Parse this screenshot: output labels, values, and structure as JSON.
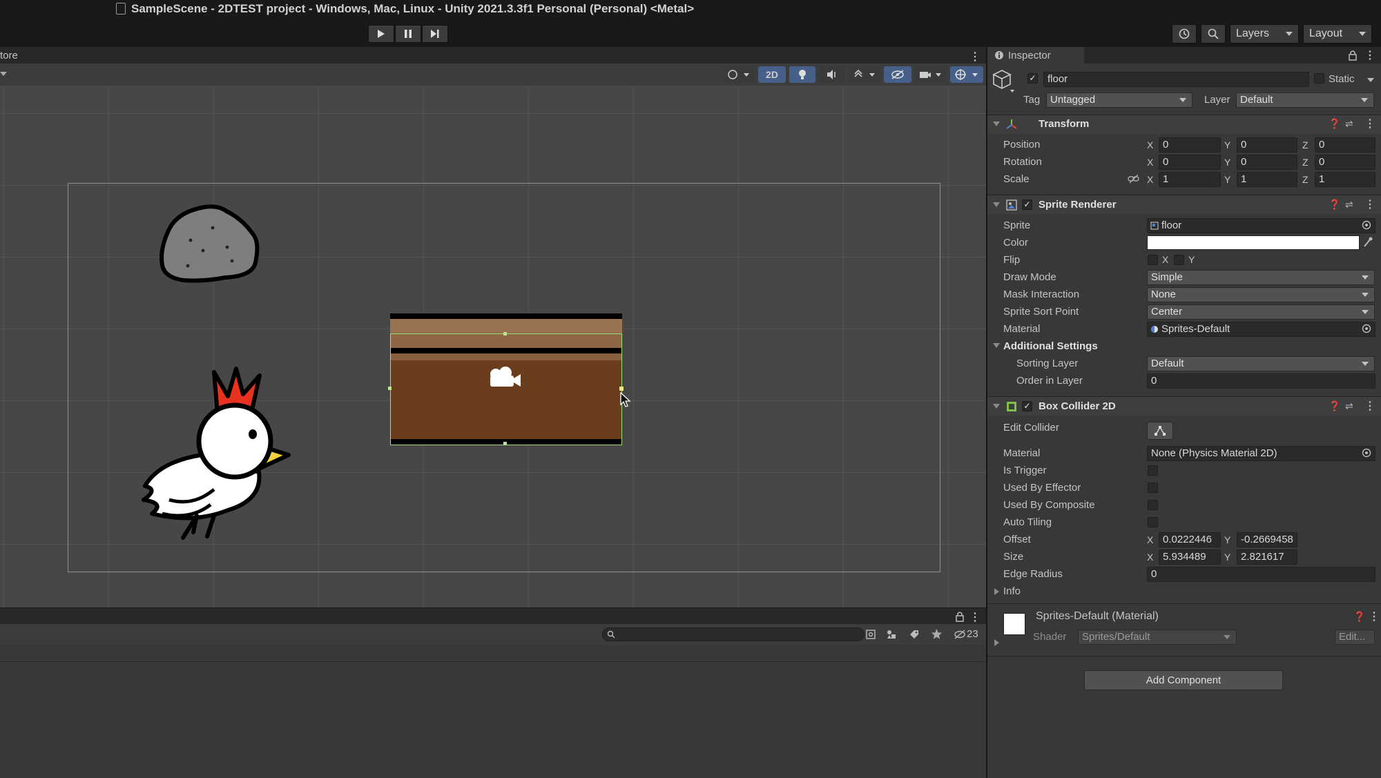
{
  "window": {
    "title": "SampleScene - 2DTEST project - Windows, Mac, Linux - Unity 2021.3.3f1 Personal (Personal) <Metal>"
  },
  "toolbar": {
    "layers_label": "Layers",
    "layout_label": "Layout"
  },
  "scene": {
    "tab_fragment": "tore",
    "mode_2d_label": "2D",
    "hidden_count": "23"
  },
  "colors": {
    "accent": "#4d82d6",
    "floor_dark": "#6a3e1c",
    "floor_light": "#9a7350"
  },
  "inspector": {
    "tab_label": "Inspector",
    "object": {
      "name": "floor",
      "static_label": "Static",
      "tag_label": "Tag",
      "tag_value": "Untagged",
      "layer_label": "Layer",
      "layer_value": "Default"
    },
    "transform": {
      "title": "Transform",
      "position_label": "Position",
      "rotation_label": "Rotation",
      "scale_label": "Scale",
      "axis_x": "X",
      "axis_y": "Y",
      "axis_z": "Z",
      "position": {
        "x": "0",
        "y": "0",
        "z": "0"
      },
      "rotation": {
        "x": "0",
        "y": "0",
        "z": "0"
      },
      "scale": {
        "x": "1",
        "y": "1",
        "z": "1"
      }
    },
    "sprite_renderer": {
      "title": "Sprite Renderer",
      "sprite_label": "Sprite",
      "sprite_value": "floor",
      "color_label": "Color",
      "flip_label": "Flip",
      "flip_x": "X",
      "flip_y": "Y",
      "draw_mode_label": "Draw Mode",
      "draw_mode_value": "Simple",
      "mask_label": "Mask Interaction",
      "mask_value": "None",
      "sort_point_label": "Sprite Sort Point",
      "sort_point_value": "Center",
      "material_label": "Material",
      "material_value": "Sprites-Default",
      "additional_label": "Additional Settings",
      "sorting_layer_label": "Sorting Layer",
      "sorting_layer_value": "Default",
      "order_label": "Order in Layer",
      "order_value": "0"
    },
    "box_collider": {
      "title": "Box Collider 2D",
      "edit_collider_label": "Edit Collider",
      "material_label": "Material",
      "material_value": "None (Physics Material 2D)",
      "is_trigger_label": "Is Trigger",
      "used_by_effector_label": "Used By Effector",
      "used_by_composite_label": "Used By Composite",
      "auto_tiling_label": "Auto Tiling",
      "offset_label": "Offset",
      "offset_x": "0.0222446",
      "offset_y": "-0.2669458",
      "size_label": "Size",
      "size_x": "5.934489",
      "size_y": "2.821617",
      "edge_radius_label": "Edge Radius",
      "edge_radius_value": "0",
      "info_label": "Info"
    },
    "material_block": {
      "title": "Sprites-Default (Material)",
      "shader_label": "Shader",
      "shader_value": "Sprites/Default",
      "edit_label": "Edit..."
    },
    "add_component_label": "Add Component"
  }
}
